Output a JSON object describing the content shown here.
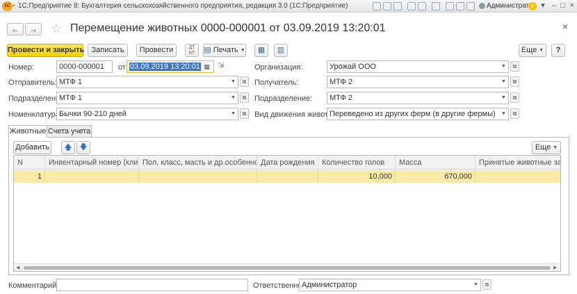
{
  "window": {
    "logo": "1С",
    "title": "1С:Предприятие 8: Бухгалтерия сельскохозяйственного предприятия, редакция 3.0 (1С:Предприятие)",
    "user": "Администратор"
  },
  "header": {
    "back": "←",
    "forward": "→",
    "title": "Перемещение животных 0000-000001 от 03.09.2019 13:20:01",
    "close": "×"
  },
  "toolbar": {
    "post_close": "Провести и закрыть",
    "save": "Записать",
    "post": "Провести",
    "dt_kt_top": "ДТ",
    "dt_kt_bottom": "КТ",
    "print": "Печать",
    "more": "Еще",
    "help": "?"
  },
  "fields": {
    "number_label": "Номер:",
    "number_value": "0000-000001",
    "date_label": "от:",
    "date_value": "03.09.2019 13:20:01",
    "org_label": "Организация:",
    "org_value": "Урожай ООО",
    "sender_label": "Отправитель:",
    "sender_value": "МТФ 1",
    "receiver_label": "Получатель:",
    "receiver_value": "МТФ 2",
    "dept_from_label": "Подразделение:",
    "dept_from_value": "МТФ 1",
    "dept_to_label": "Подразделение:",
    "dept_to_value": "МТФ 2",
    "nomen_label": "Номенклатура:",
    "nomen_value": "Бычки 90-210 дней",
    "movement_label": "Вид движения животных:",
    "movement_value": "Переведено из других ферм (в другие фермы)"
  },
  "tabs": [
    {
      "label": "Животные"
    },
    {
      "label": "Счета учета"
    }
  ],
  "table_toolbar": {
    "add": "Добавить",
    "more": "Еще"
  },
  "table": {
    "columns": [
      "N",
      "Инвентарный номер (кличка)",
      "Пол, класс, масть и др.особенности",
      "Дата рождения",
      "Количество голов",
      "Масса",
      "Принятые животные закрепл"
    ],
    "rows": [
      {
        "n": "1",
        "inventory": "",
        "features": "",
        "birth": "",
        "count": "10,000",
        "mass": "670,000",
        "assigned": ""
      }
    ]
  },
  "footer": {
    "comment_label": "Комментарий:",
    "comment_value": "",
    "responsible_label": "Ответственный:",
    "responsible_value": "Администратор"
  },
  "colors": {
    "primary_button": "#f5d100",
    "selected_row": "#fbeaa6",
    "selection": "#3d73c9"
  }
}
